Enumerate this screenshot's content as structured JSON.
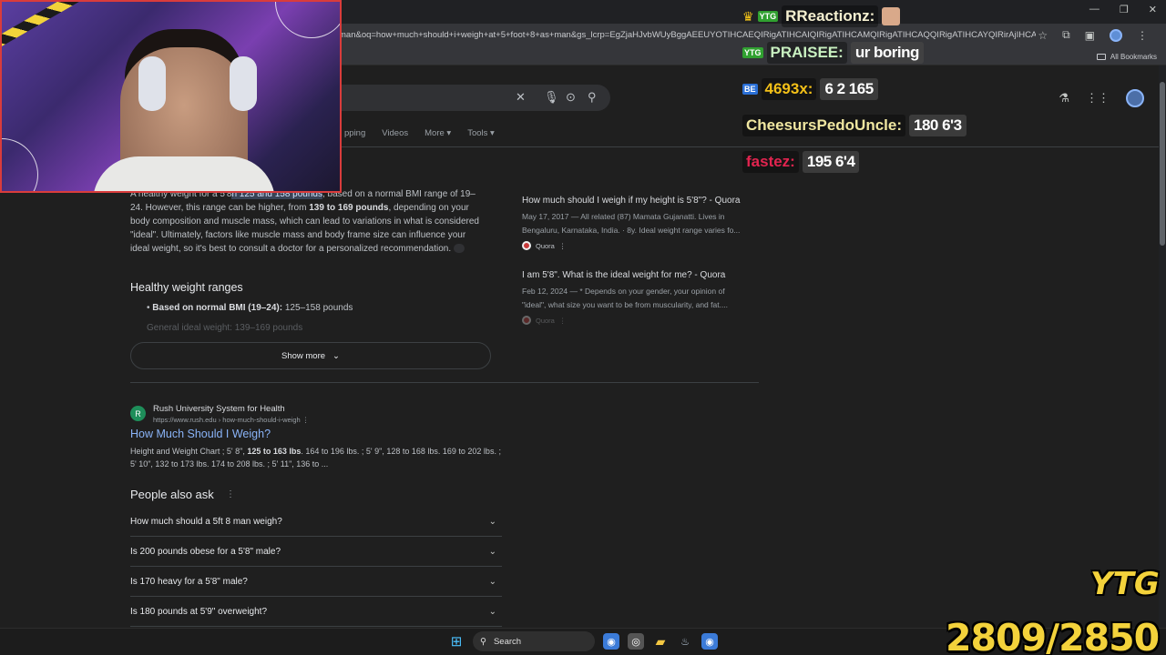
{
  "browser": {
    "url": "man&oq=how+much+should+i+weigh+at+5+foot+8+as+man&gs_lcrp=EgZjaHJvbWUyBggAEEUYOTIHCAEQIRigATIHCAIQIRigATIHCAMQIRigATIHCAQQIRigATIHCAYQIRirAjIHCA...",
    "all_bookmarks": "All Bookmarks"
  },
  "search": {
    "tabs": [
      "pping",
      "Videos",
      "More",
      "Tools"
    ]
  },
  "overview": {
    "t1": "A healthy weight for a 5'8",
    "hl1": "n 125 and 158 pounds",
    "t2": ", based on a normal BMI range of 19–24. However, this range can be higher, from ",
    "b1": "139 to 169 pounds",
    "t3": ", depending on your body composition and muscle mass, which can lead to variations in what is considered \"ideal\". Ultimately, factors like muscle mass and body frame size can influence your ideal weight, so it's best to consult a doctor for a personalized recommendation.",
    "subheading": "Healthy weight ranges",
    "bullet_bold": "Based on normal BMI (19–24):",
    "bullet_rest": " 125–158 pounds",
    "bullet_faded": "General ideal weight: 139–169 pounds",
    "show_more": "Show more"
  },
  "result": {
    "icon": "R",
    "site_name": "Rush University System for Health",
    "site_url": "https://www.rush.edu › how-much-should-i-weigh",
    "title": "How Much Should I Weigh?",
    "snippet_a": "Height and Weight Chart ; 5' 8\", ",
    "snippet_b": "125 to 163 lbs",
    "snippet_c": ". 164 to 196 lbs. ; 5' 9\", 128 to 168 lbs. 169 to 202 lbs. ; 5' 10\", 132 to 173 lbs. 174 to 208 lbs. ; 5' 11\", 136 to ..."
  },
  "paa": {
    "heading": "People also ask",
    "questions": [
      "How much should a 5ft 8 man weigh?",
      "Is 200 pounds obese for a 5'8\" male?",
      "Is 170 heavy for a 5'8\" male?",
      "Is 180 pounds at 5'9\" overweight?"
    ]
  },
  "quora": [
    {
      "title": "How much should I weigh if my height is 5'8\"? - Quora",
      "meta": "May 17, 2017 — All related (87) Mamata Gujanatti. Lives in Bengaluru, Karnataka, India. · 8y. Ideal weight range varies fo...",
      "source": "Quora"
    },
    {
      "title": "I am 5'8\". What is the ideal weight for me? - Quora",
      "meta": "Feb 12, 2024 — * Depends on your gender, your opinion of \"ideal\", what size you want to be from muscularity, and fat....",
      "source": "Quora"
    }
  ],
  "chat": [
    {
      "name": "RReactionz:",
      "msg": "",
      "color": "#f5f0d0",
      "badge": "YTG"
    },
    {
      "name": "PRAISEE:",
      "msg": "ur boring",
      "color": "#c8f0c0",
      "badge": "YTG"
    },
    {
      "name": "4693x:",
      "msg": "6 2 165",
      "color": "#f3c018",
      "badge": "BE"
    },
    {
      "name": "CheesursPedoUncle:",
      "msg": "180 6'3",
      "color": "#efe6a0",
      "badge": ""
    },
    {
      "name": "fastez:",
      "msg": "195 6'4",
      "color": "#e2244f",
      "badge": ""
    }
  ],
  "taskbar": {
    "search_label": "Search"
  },
  "counter": "2809/2850",
  "logo": "YTG"
}
